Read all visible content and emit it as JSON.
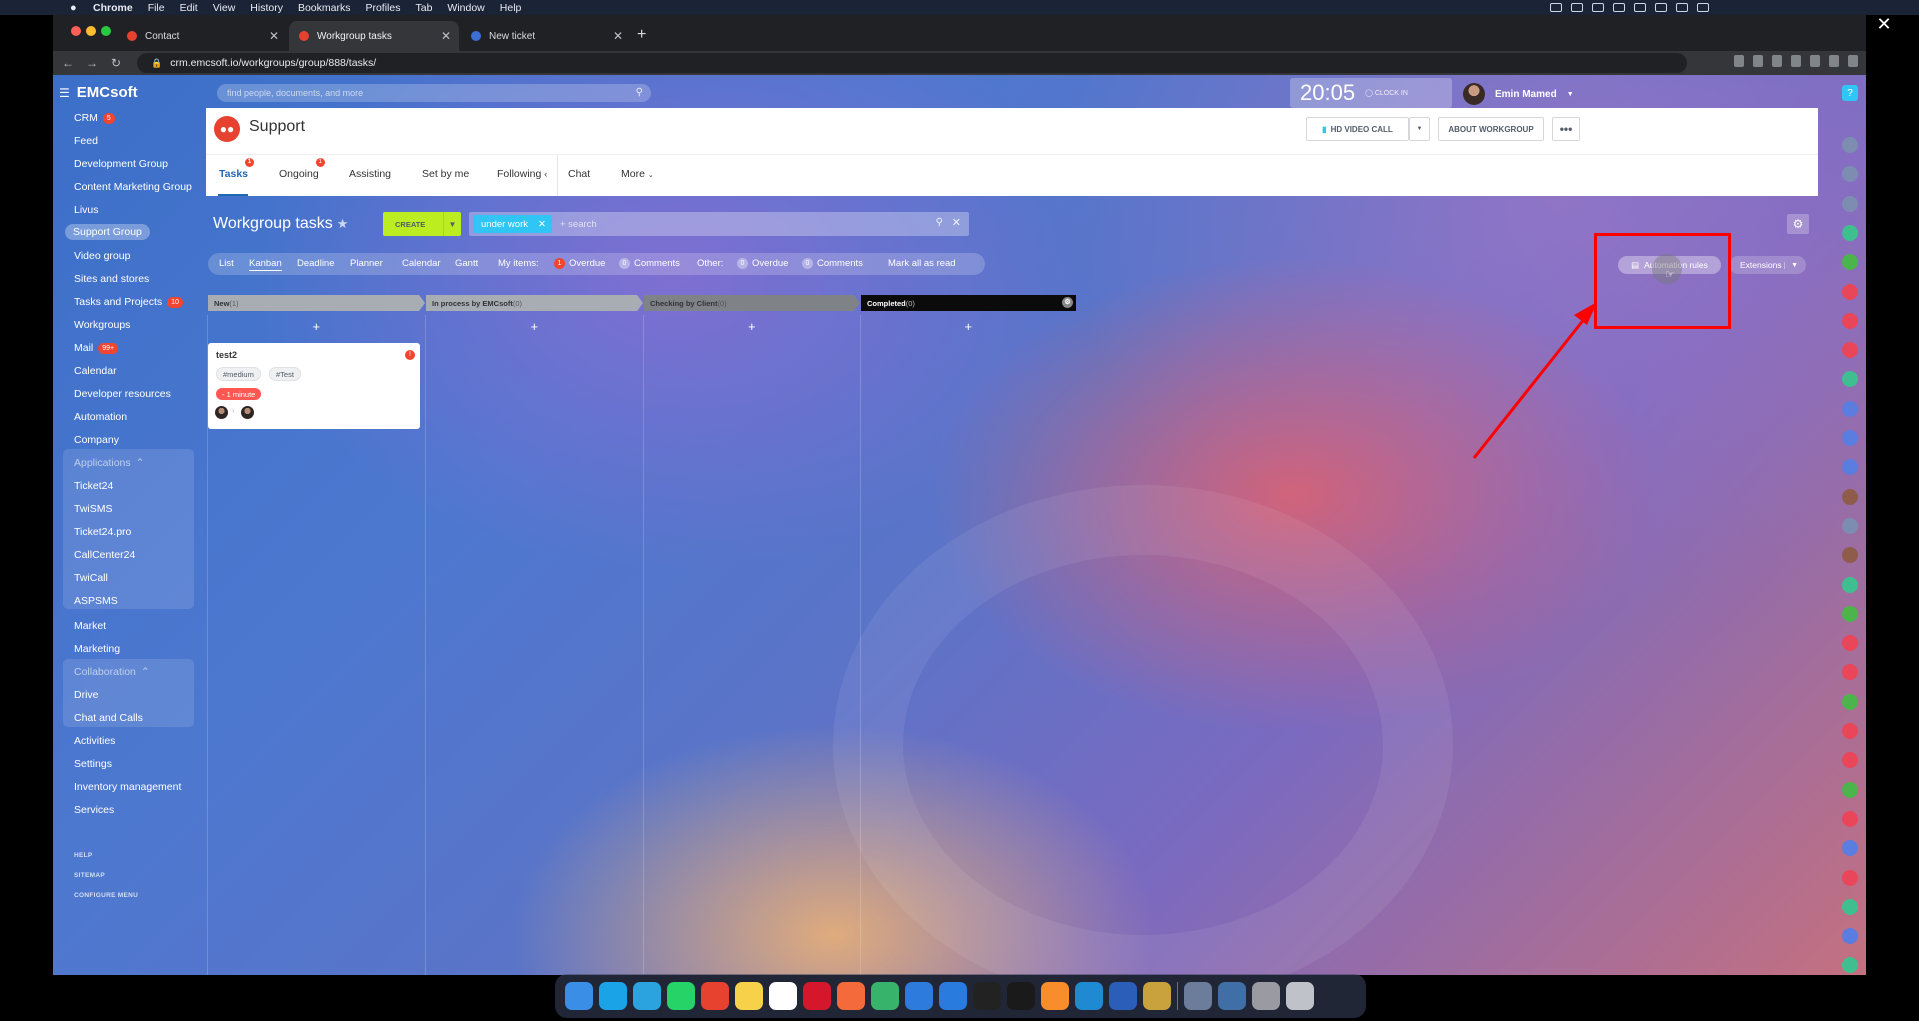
{
  "menubar": {
    "app": "Chrome",
    "items": [
      "File",
      "Edit",
      "View",
      "History",
      "Bookmarks",
      "Profiles",
      "Tab",
      "Window",
      "Help"
    ]
  },
  "browser": {
    "tabs": [
      {
        "title": "Contact",
        "active": false
      },
      {
        "title": "Workgroup tasks",
        "active": true
      },
      {
        "title": "New ticket",
        "active": false
      }
    ],
    "url": "crm.emcsoft.io/workgroups/group/888/tasks/"
  },
  "portal": {
    "logo": "EMCsoft",
    "search_placeholder": "find people, documents, and more",
    "clock_time": "20:05",
    "clock_label": "CLOCK IN",
    "user_name": "Emin Mamed",
    "help": "?"
  },
  "leftmenu": {
    "items": [
      {
        "label": "CRM",
        "counter": "5"
      },
      {
        "label": "Feed"
      },
      {
        "label": "Development Group"
      },
      {
        "label": "Content Marketing Group"
      },
      {
        "label": "Livus"
      },
      {
        "label": "Support Group",
        "active": true
      },
      {
        "label": "Video group"
      },
      {
        "label": "Sites and stores"
      },
      {
        "label": "Tasks and Projects",
        "counter": "10"
      },
      {
        "label": "Workgroups"
      },
      {
        "label": "Mail",
        "counter": "99+"
      },
      {
        "label": "Calendar"
      },
      {
        "label": "Developer resources"
      },
      {
        "label": "Automation"
      },
      {
        "label": "Company"
      }
    ],
    "applications_title": "Applications",
    "applications": [
      "Ticket24",
      "TwiSMS",
      "Ticket24.pro",
      "CallCenter24",
      "TwiCall",
      "ASPSMS"
    ],
    "after_apps": [
      "Market",
      "Marketing"
    ],
    "collaboration_title": "Collaboration",
    "collaboration": [
      "Drive",
      "Chat and Calls"
    ],
    "after_collab": [
      "Activities",
      "Settings",
      "Inventory management",
      "Services"
    ],
    "footer": [
      "HELP",
      "SITEMAP",
      "CONFIGURE MENU"
    ]
  },
  "group": {
    "title": "Support",
    "video_call": "HD VIDEO CALL",
    "about": "ABOUT WORKGROUP",
    "tabs": [
      {
        "label": "Tasks",
        "badge": "1",
        "active": true
      },
      {
        "label": "Ongoing",
        "badge": "1"
      },
      {
        "label": "Assisting"
      },
      {
        "label": "Set by me"
      },
      {
        "label": "Following"
      },
      {
        "label": "Chat"
      },
      {
        "label": "More"
      }
    ]
  },
  "tasks": {
    "title": "Workgroup tasks",
    "create": "CREATE",
    "filter_chip": "under work",
    "filter_hint": "+ search",
    "views": [
      "List",
      "Kanban",
      "Deadline",
      "Planner",
      "Calendar",
      "Gantt"
    ],
    "active_view": "Kanban",
    "my_items_label": "My items:",
    "my_overdue_count": "1",
    "my_overdue": "Overdue",
    "my_comments_count": "0",
    "my_comments": "Comments",
    "other_label": "Other:",
    "other_overdue_count": "0",
    "other_overdue": "Overdue",
    "other_comments_count": "0",
    "other_comments": "Comments",
    "mark_all": "Mark all as read",
    "automation": "Automation rules",
    "extensions": "Extensions"
  },
  "kanban": {
    "columns": [
      {
        "name": "New",
        "count": "(1)",
        "color": "#a8adb4"
      },
      {
        "name": "In process by EMCsoft",
        "count": "(0)",
        "color": "#a8adb4"
      },
      {
        "name": "Checking by Client",
        "count": "(0)",
        "color": "#7f8388"
      },
      {
        "name": "Completed",
        "count": "(0)",
        "color": "#0b0b0b"
      }
    ],
    "card": {
      "title": "test2",
      "alert": "!",
      "tags": [
        "#medium",
        "#Test"
      ],
      "deadline": "- 1 minute"
    }
  },
  "colors": {
    "accent": "#2fc6f6",
    "create": "#bbed21",
    "annotation": "#ff0000",
    "group_icon": "#e7412f"
  }
}
